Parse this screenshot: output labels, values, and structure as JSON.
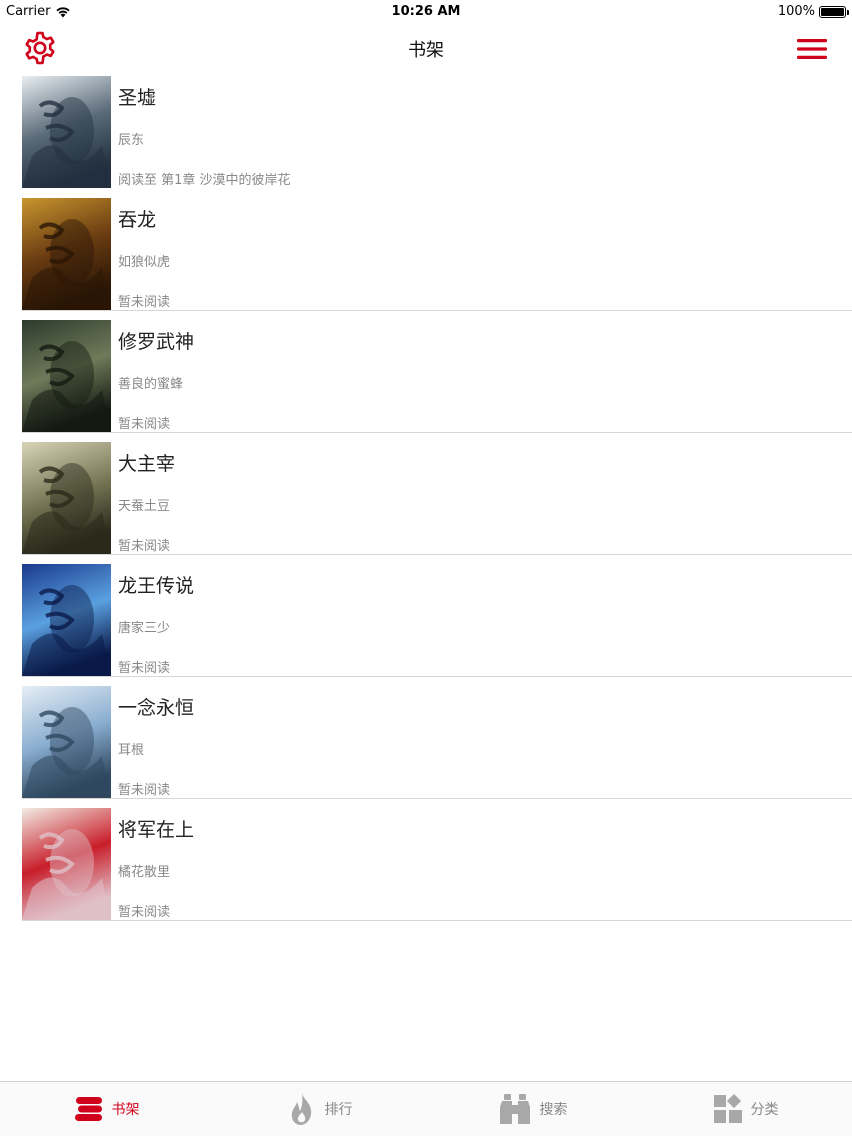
{
  "status_bar": {
    "carrier": "Carrier",
    "time": "10:26 AM",
    "battery": "100%"
  },
  "nav": {
    "title": "书架",
    "left_icon": "gear-icon",
    "right_icon": "hamburger-menu-icon"
  },
  "colors": {
    "accent": "#d0021b",
    "inactive": "#8e8e8e",
    "divider": "#d6d6d6"
  },
  "books": [
    {
      "title": "圣墟",
      "author": "辰东",
      "progress": "阅读至 第1章 沙漠中的彼岸花",
      "cover_colors": [
        "#e8eef2",
        "#5a6a78",
        "#223040"
      ]
    },
    {
      "title": "吞龙",
      "author": "如狼似虎",
      "progress": "暂未阅读",
      "cover_colors": [
        "#c9962e",
        "#6a3c12",
        "#2a1606"
      ]
    },
    {
      "title": "修罗武神",
      "author": "善良的蜜蜂",
      "progress": "暂未阅读",
      "cover_colors": [
        "#2c3a2c",
        "#6f7a5a",
        "#141a12"
      ]
    },
    {
      "title": "大主宰",
      "author": "天蚕土豆",
      "progress": "暂未阅读",
      "cover_colors": [
        "#d8d4b8",
        "#7a7a58",
        "#2a2a1c"
      ]
    },
    {
      "title": "龙王传说",
      "author": "唐家三少",
      "progress": "暂未阅读",
      "cover_colors": [
        "#1a3a8a",
        "#5aa0e0",
        "#0a1a48"
      ]
    },
    {
      "title": "一念永恒",
      "author": "耳根",
      "progress": "暂未阅读",
      "cover_colors": [
        "#e6eef6",
        "#8aaed0",
        "#304860"
      ]
    },
    {
      "title": "将军在上",
      "author": "橘花散里",
      "progress": "暂未阅读",
      "cover_colors": [
        "#f2ece4",
        "#c81e2a",
        "#e0c0c8"
      ]
    }
  ],
  "tabs": [
    {
      "label": "书架",
      "icon": "bookshelf-icon",
      "active": true
    },
    {
      "label": "排行",
      "icon": "flame-icon",
      "active": false
    },
    {
      "label": "搜索",
      "icon": "binoculars-icon",
      "active": false
    },
    {
      "label": "分类",
      "icon": "category-grid-icon",
      "active": false
    }
  ]
}
